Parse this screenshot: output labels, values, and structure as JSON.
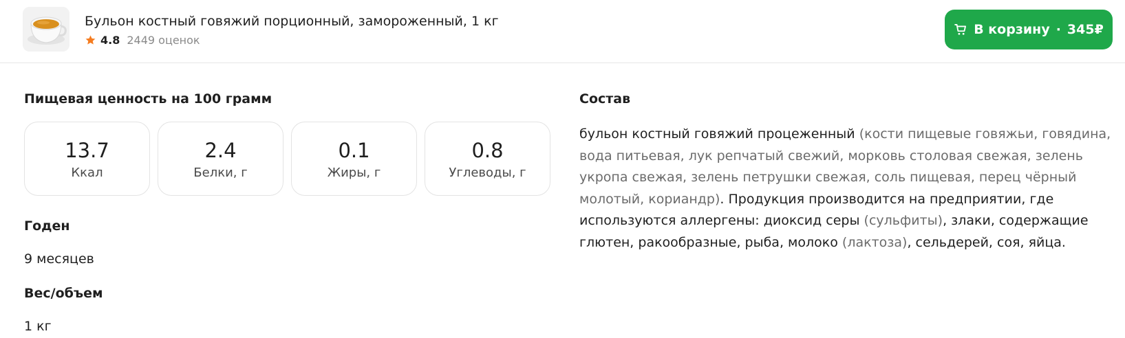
{
  "header": {
    "product_title": "Бульон костный говяжий порционный, замороженный, 1 кг",
    "rating": "4.8",
    "reviews": "2449 оценок",
    "cart_label": "В корзину",
    "cart_separator": "·",
    "price": "345₽",
    "icons": [
      "product-thumbnail-broth-cup",
      "star-icon",
      "cart-icon"
    ],
    "colors": {
      "accent": "#1fa84a",
      "star": "#f57c1f"
    }
  },
  "nutrition": {
    "title": "Пищевая ценность на 100 грамм",
    "items": [
      {
        "value": "13.7",
        "label": "Ккал"
      },
      {
        "value": "2.4",
        "label": "Белки, г"
      },
      {
        "value": "0.1",
        "label": "Жиры, г"
      },
      {
        "value": "0.8",
        "label": "Углеводы, г"
      }
    ]
  },
  "shelf_life": {
    "title": "Годен",
    "value": "9 месяцев"
  },
  "weight": {
    "title": "Вес/объем",
    "value": "1 кг"
  },
  "composition": {
    "title": "Состав",
    "segments": [
      "бульон костный говяжий процеженный ",
      "(кости пищевые говяжьи, говядина, вода питьевая, лук репчатый свежий, морковь столовая свежая, зелень укропа свежая, зелень петрушки свежая, соль пищевая, перец чёрный молотый, кориандр)",
      ". Продукция производится на предприятии, где используются аллергены: диоксид серы ",
      "(сульфиты)",
      ", злаки, содержащие глютен, ракообразные, рыба, молоко ",
      "(лактоза)",
      ", сельдерей, соя, яйца."
    ]
  }
}
